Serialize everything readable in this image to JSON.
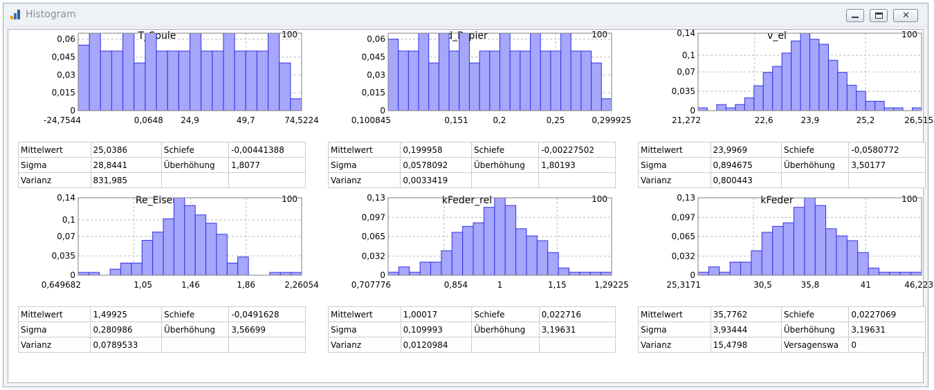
{
  "window": {
    "title": "Histogram",
    "icon": "bar-chart-icon",
    "controls": [
      "minimize-icon",
      "restore-icon",
      "close-icon"
    ]
  },
  "labels": {
    "mean": "Mittelwert",
    "sigma": "Sigma",
    "variance": "Varianz",
    "skew": "Schiefe",
    "excess": "Überhöhung",
    "failure": "Versagenswa"
  },
  "colors": {
    "bar_fill": "#a6a6fb",
    "bar_stroke": "#2f2fe6"
  },
  "chart_data": [
    {
      "type": "bar",
      "title": "T_Spule",
      "count": "100",
      "y_ticks": [
        "0,06",
        "0,045",
        "0,03",
        "0,015",
        "0"
      ],
      "y_tick_values": [
        0.06,
        0.045,
        0.03,
        0.015,
        0
      ],
      "ylim": [
        0,
        0.065
      ],
      "x_ticks": [
        "-24,7544",
        "0,0648",
        "24,9",
        "49,7",
        "74,5224"
      ],
      "x_tick_values": [
        -24.7544,
        0.0648,
        24.9,
        49.7,
        74.5224
      ],
      "xlim": [
        -24.7544,
        74.5224
      ],
      "values": [
        0.055,
        0.065,
        0.05,
        0.05,
        0.065,
        0.04,
        0.065,
        0.05,
        0.05,
        0.05,
        0.065,
        0.05,
        0.05,
        0.065,
        0.05,
        0.05,
        0.05,
        0.065,
        0.04,
        0.01
      ],
      "stats": {
        "mean": "25,0386",
        "sigma": "28,8441",
        "variance": "831,985",
        "skew": "-0,00441388",
        "excess": "1,8077"
      }
    },
    {
      "type": "bar",
      "title": "d_Papier",
      "count": "100",
      "y_ticks": [
        "0,06",
        "0,045",
        "0,03",
        "0,015",
        "0"
      ],
      "y_tick_values": [
        0.06,
        0.045,
        0.03,
        0.015,
        0
      ],
      "ylim": [
        0,
        0.065
      ],
      "x_ticks": [
        "0,100845",
        "0,151",
        "0,2",
        "0,25",
        "0,299925"
      ],
      "x_tick_values": [
        0.100845,
        0.151,
        0.2,
        0.25,
        0.299925
      ],
      "xlim": [
        0.100845,
        0.299925
      ],
      "values": [
        0.06,
        0.05,
        0.05,
        0.065,
        0.04,
        0.065,
        0.05,
        0.065,
        0.04,
        0.05,
        0.05,
        0.065,
        0.05,
        0.05,
        0.065,
        0.05,
        0.05,
        0.065,
        0.05,
        0.05,
        0.04,
        0.01
      ],
      "stats": {
        "mean": "0,199958",
        "sigma": "0,0578092",
        "variance": "0,0033419",
        "skew": "-0,00227502",
        "excess": "1,80193"
      }
    },
    {
      "type": "bar",
      "title": "v_el",
      "count": "100",
      "y_ticks": [
        "0,14",
        "0,1",
        "0,07",
        "0,035",
        "0"
      ],
      "y_tick_values": [
        0.14,
        0.1,
        0.07,
        0.035,
        0
      ],
      "ylim": [
        0,
        0.14
      ],
      "x_ticks": [
        "21,272",
        "22,6",
        "23,9",
        "25,2",
        "26,5154"
      ],
      "x_tick_values": [
        21.272,
        22.6,
        23.9,
        25.2,
        26.5154
      ],
      "xlim": [
        21.272,
        26.5154
      ],
      "values": [
        0.005,
        0,
        0.011,
        0.005,
        0.011,
        0.023,
        0.045,
        0.069,
        0.08,
        0.104,
        0.126,
        0.14,
        0.129,
        0.12,
        0.091,
        0.069,
        0.046,
        0.035,
        0.017,
        0.017,
        0.005,
        0.005,
        0,
        0.005
      ],
      "stats": {
        "mean": "23,9969",
        "sigma": "0,894675",
        "variance": "0,800443",
        "skew": "-0,0580772",
        "excess": "3,50177"
      }
    },
    {
      "type": "bar",
      "title": "Re_Eisen",
      "count": "100",
      "y_ticks": [
        "0,14",
        "0,1",
        "0,07",
        "0,035",
        "0"
      ],
      "y_tick_values": [
        0.14,
        0.1,
        0.07,
        0.035,
        0
      ],
      "ylim": [
        0,
        0.14
      ],
      "x_ticks": [
        "0,649682",
        "1,05",
        "1,46",
        "1,86",
        "2,26054"
      ],
      "x_tick_values": [
        0.649682,
        1.05,
        1.46,
        1.86,
        2.26054
      ],
      "xlim": [
        0.649682,
        2.26054
      ],
      "values": [
        0.005,
        0.005,
        0,
        0.011,
        0.022,
        0.022,
        0.063,
        0.078,
        0.102,
        0.14,
        0.126,
        0.109,
        0.094,
        0.074,
        0.022,
        0.033,
        0,
        0,
        0.005,
        0.005,
        0.005
      ],
      "stats": {
        "mean": "1,49925",
        "sigma": "0,280986",
        "variance": "0,0789533",
        "skew": "-0,0491628",
        "excess": "3,56699"
      }
    },
    {
      "type": "bar",
      "title": "kFeder_rel",
      "count": "100",
      "y_ticks": [
        "0,13",
        "0,097",
        "0,065",
        "0,032",
        "0"
      ],
      "y_tick_values": [
        0.13,
        0.097,
        0.065,
        0.032,
        0
      ],
      "ylim": [
        0,
        0.13
      ],
      "x_ticks": [
        "0,707776",
        "0,854",
        "1",
        "1,15",
        "1,29225"
      ],
      "x_tick_values": [
        0.707776,
        0.854,
        1,
        1.15,
        1.29225
      ],
      "xlim": [
        0.707776,
        1.29225
      ],
      "values": [
        0.005,
        0.014,
        0.005,
        0.022,
        0.022,
        0.041,
        0.072,
        0.082,
        0.088,
        0.114,
        0.13,
        0.117,
        0.078,
        0.066,
        0.058,
        0.038,
        0.012,
        0.005,
        0.005,
        0.005,
        0.005
      ],
      "stats": {
        "mean": "1,00017",
        "sigma": "0,109993",
        "variance": "0,0120984",
        "skew": "0,022716",
        "excess": "3,19631"
      }
    },
    {
      "type": "bar",
      "title": "kFeder",
      "count": "100",
      "y_ticks": [
        "0,13",
        "0,097",
        "0,065",
        "0,032",
        "0"
      ],
      "y_tick_values": [
        0.13,
        0.097,
        0.065,
        0.032,
        0
      ],
      "ylim": [
        0,
        0.13
      ],
      "x_ticks": [
        "25,3171",
        "30,5",
        "35,8",
        "41",
        "46,2238"
      ],
      "x_tick_values": [
        25.3171,
        30.5,
        35.8,
        41,
        46.2238
      ],
      "xlim": [
        25.3171,
        46.2238
      ],
      "values": [
        0.005,
        0.014,
        0.005,
        0.022,
        0.022,
        0.041,
        0.072,
        0.082,
        0.088,
        0.114,
        0.13,
        0.117,
        0.078,
        0.066,
        0.058,
        0.038,
        0.012,
        0.005,
        0.005,
        0.005,
        0.005
      ],
      "stats": {
        "mean": "35,7762",
        "sigma": "3,93444",
        "variance": "15,4798",
        "skew": "0,0227069",
        "excess": "3,19631",
        "failure": "0"
      }
    }
  ]
}
